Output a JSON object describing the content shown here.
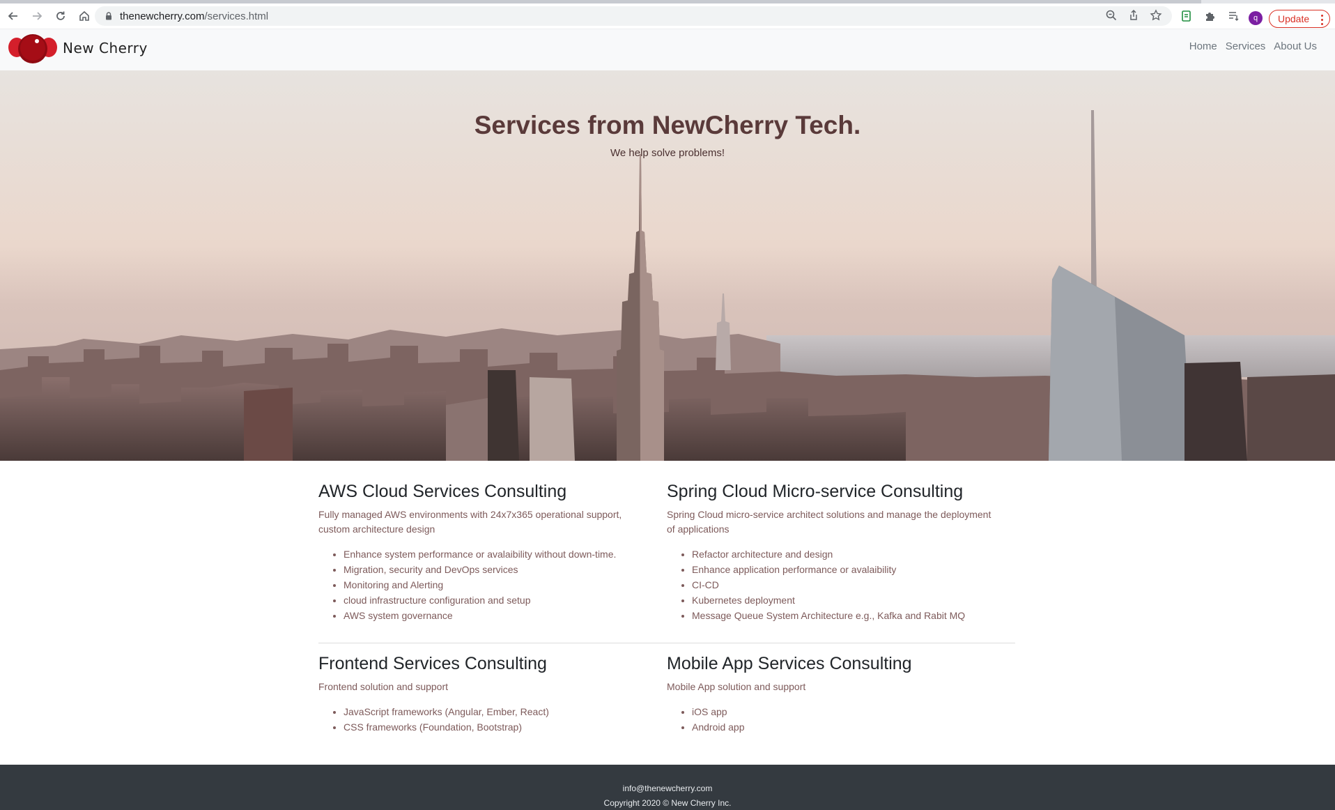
{
  "browser": {
    "url_host": "thenewcherry.com",
    "url_path": "/services.html",
    "profile_initial": "q",
    "update_label": "Update",
    "load_progress": 0.9
  },
  "navbar": {
    "brand": "New Cherry",
    "links": [
      "Home",
      "Services",
      "About Us"
    ]
  },
  "hero": {
    "title": "Services from NewCherry Tech.",
    "subtitle": "We help solve problems!"
  },
  "services": [
    {
      "title": "AWS Cloud Services Consulting",
      "description": "Fully managed AWS environments with 24x7x365 operational support, custom architecture design",
      "items": [
        "Enhance system performance or avalaibility without down-time.",
        "Migration, security and DevOps services",
        "Monitoring and Alerting",
        "cloud infrastructure configuration and setup",
        "AWS system governance"
      ]
    },
    {
      "title": "Spring Cloud Micro-service Consulting",
      "description": "Spring Cloud micro-service architect solutions and manage the deployment of applications",
      "items": [
        "Refactor architecture and design",
        "Enhance application performance or avalaibility",
        "CI-CD",
        "Kubernetes deployment",
        "Message Queue System Architecture e.g., Kafka and Rabit MQ"
      ]
    },
    {
      "title": "Frontend Services Consulting",
      "description": "Frontend solution and support",
      "items": [
        "JavaScript frameworks (Angular, Ember, React)",
        "CSS frameworks (Foundation, Bootstrap)"
      ]
    },
    {
      "title": "Mobile App Services Consulting",
      "description": "Mobile App solution and support",
      "items": [
        "iOS app",
        "Android app"
      ]
    }
  ],
  "footer": {
    "email": "info@thenewcherry.com",
    "copyright": "Copyright 2020 © New Cherry Inc."
  },
  "colors": {
    "brand_red": "#b0101a",
    "heading_brown": "#5a3a3a",
    "body_brown": "#7d5a5a",
    "footer_bg": "#343a40"
  }
}
